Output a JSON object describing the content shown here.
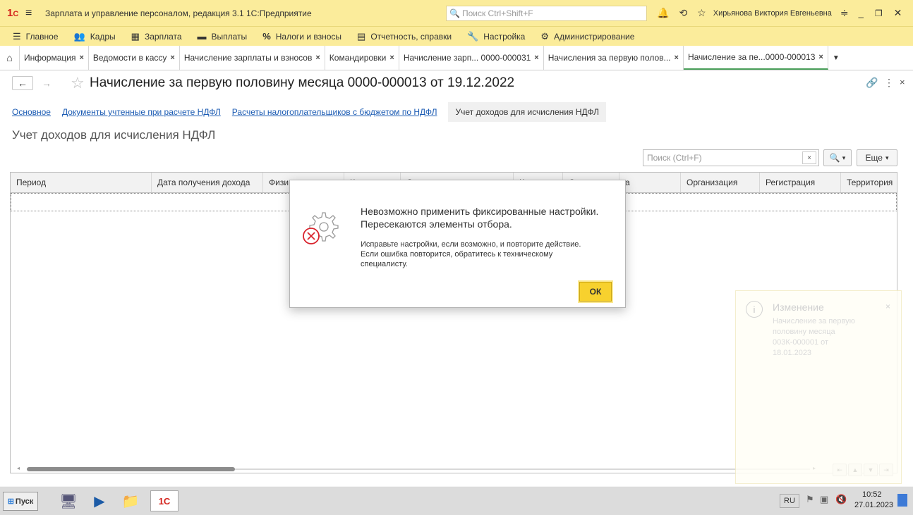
{
  "titlebar": {
    "app_title": "Зарплата и управление персоналом, редакция 3.1 1С:Предприятие",
    "search_placeholder": "Поиск Ctrl+Shift+F",
    "user": "Хирьянова Виктория Евгеньевна"
  },
  "menu": [
    {
      "label": "Главное",
      "icon": "☰"
    },
    {
      "label": "Кадры",
      "icon": "👥"
    },
    {
      "label": "Зарплата",
      "icon": "▦"
    },
    {
      "label": "Выплаты",
      "icon": "▬"
    },
    {
      "label": "Налоги и взносы",
      "icon": "%"
    },
    {
      "label": "Отчетность, справки",
      "icon": "▤"
    },
    {
      "label": "Настройка",
      "icon": "🔧"
    },
    {
      "label": "Администрирование",
      "icon": "⚙"
    }
  ],
  "tabs": [
    {
      "label": "Информация"
    },
    {
      "label": "Ведомости в кассу"
    },
    {
      "label": "Начисление зарплаты и взносов"
    },
    {
      "label": "Командировки"
    },
    {
      "label": "Начисление зарп... 0000-000031"
    },
    {
      "label": "Начисления за первую полов..."
    },
    {
      "label": "Начисление за пе...0000-000013"
    }
  ],
  "document": {
    "title": "Начисление за первую половину месяца 0000-000013 от 19.12.2022",
    "links": [
      "Основное",
      "Документы учтенные при расчете НДФЛ",
      "Расчеты налогоплательщиков с бюджетом по НДФЛ"
    ],
    "active_section": "Учет доходов для исчисления НДФЛ",
    "section_title": "Учет доходов для исчисления НДФЛ"
  },
  "toolbar": {
    "search_placeholder": "Поиск (Ctrl+F)",
    "more_label": "Еще"
  },
  "columns": [
    "Период",
    "Дата получения дохода",
    "Физи",
    "К",
    "С",
    "К",
    "С",
    "а",
    "Организация",
    "Регистрация",
    "Территория"
  ],
  "dialog": {
    "heading_line1": "Невозможно применить фиксированные настройки.",
    "heading_line2": "Пересекаются элементы отбора.",
    "body_line1": "Исправьте настройки, если возможно, и повторите действие.",
    "body_line2": "Если ошибка повторится, обратитесь к техническому",
    "body_line3": "специалисту.",
    "ok_label": "ОК"
  },
  "notification": {
    "title": "Изменение",
    "line1": "Начисление за первую",
    "line2": "половину месяца",
    "line3": "003К-000001 от",
    "line4": "18.01.2023"
  },
  "taskbar": {
    "start_label": "Пуск",
    "lang": "RU",
    "time": "10:52",
    "date": "27.01.2023"
  },
  "colors": {
    "header_bg": "#fbec9b",
    "link": "#1b5bb3",
    "accent_yellow": "#f7d12e",
    "error_red": "#d9232d"
  }
}
